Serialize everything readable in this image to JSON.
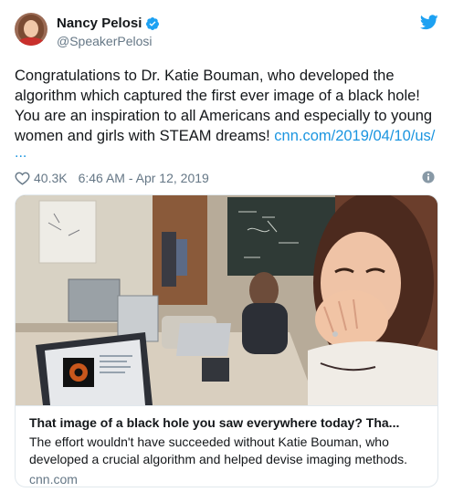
{
  "author": {
    "display_name": "Nancy Pelosi",
    "handle": "@SpeakerPelosi",
    "verified": true
  },
  "tweet": {
    "text": "Congratulations to Dr. Katie Bouman, who developed the algorithm which captured the first ever image of a black hole! You are an inspiration to all Americans and especially to young women and girls with STEAM dreams! ",
    "link": "cnn.com/2019/04/10/us/",
    "link_continuation": "...",
    "likes": "40.3K",
    "timestamp": "6:46 AM - Apr 12, 2019"
  },
  "card": {
    "title": "That image of a black hole you saw everywhere today? Tha...",
    "description": "The effort wouldn't have succeeded without Katie Bouman, who developed a crucial algorithm and helped devise imaging methods.",
    "domain": "cnn.com"
  },
  "icons": {
    "verified": "verified-badge-icon",
    "logo": "twitter-bird-icon",
    "like": "heart-icon",
    "info": "info-icon"
  },
  "colors": {
    "accent": "#1da1f2",
    "link": "#1b95e0",
    "secondary_text": "#657786",
    "border": "#e1e8ed"
  }
}
